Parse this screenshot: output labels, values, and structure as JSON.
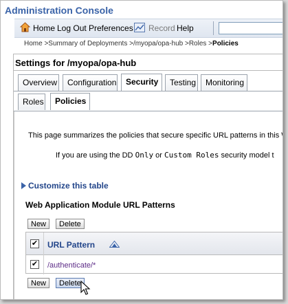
{
  "app": {
    "title": "Administration Console"
  },
  "toolbar": {
    "home": "Home",
    "logout": "Log Out",
    "preferences": "Preferences",
    "record": "Record",
    "help": "Help",
    "search_value": ""
  },
  "breadcrumb": {
    "path": "Home >Summary of Deployments >/myopa/opa-hub >Roles >",
    "current": "Policies"
  },
  "page": {
    "title": "Settings for /myopa/opa-hub"
  },
  "tabs": [
    {
      "label": "Overview"
    },
    {
      "label": "Configuration"
    },
    {
      "label": "Security",
      "active": true
    },
    {
      "label": "Testing"
    },
    {
      "label": "Monitoring"
    }
  ],
  "subtabs": [
    {
      "label": "Roles"
    },
    {
      "label": "Policies",
      "active": true
    }
  ],
  "description": {
    "summary": "This page summarizes the policies that secure specific URL patterns in this W",
    "note_prefix": "If you are using the DD",
    "note_code1": "Only",
    "note_mid": "or",
    "note_code2": "Custom Roles",
    "note_suffix": "security model t"
  },
  "customize": {
    "label": "Customize this table"
  },
  "table": {
    "title": "Web Application Module URL Patterns",
    "new_label": "New",
    "delete_label": "Delete",
    "column_header": "URL Pattern",
    "rows": [
      {
        "url_pattern": "/authenticate/*",
        "checked": true
      }
    ],
    "header_checked": true
  },
  "colors": {
    "brand_title": "#3a63a8",
    "link": "#22458a",
    "cell_link": "#5b2a86"
  },
  "icons": [
    "home-icon",
    "record-icon",
    "sort-ascending-icon",
    "expand-triangle-icon",
    "mouse-cursor-icon"
  ]
}
